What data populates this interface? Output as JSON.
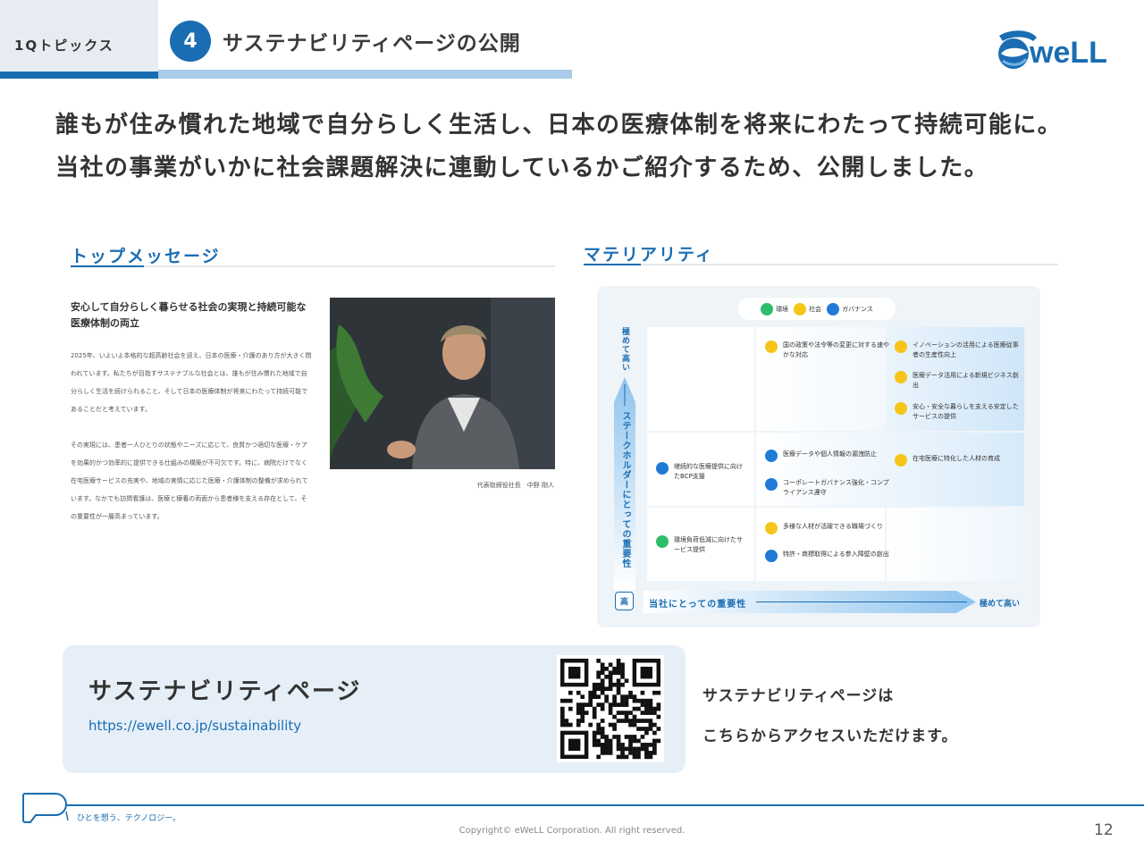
{
  "header": {
    "section_tab": "1Qトピックス",
    "topic_number": "4",
    "topic_title": "サステナビリティページの公開",
    "logo_text": "weLL"
  },
  "lead": {
    "line1": "誰もが住み慣れた地域で自分らしく生活し、日本の医療体制を将来にわたって持続可能に。",
    "line2": "当社の事業がいかに社会課題解決に連動しているかご紹介するため、公開しました。"
  },
  "top_message": {
    "title": "トップメッセージ",
    "heading": "安心して自分らしく暮らせる社会の実現と持続可能な医療体制の両立",
    "paragraph1": "2025年、いよいよ本格的な超高齢社会を迎え、日本の医療・介護のあり方が大きく問われています。私たちが目指すサステナブルな社会とは、誰もが住み慣れた地域で自分らしく生活を続けられること、そして日本の医療体制が将来にわたって持続可能であることだと考えています。",
    "paragraph2": "その実現には、患者一人ひとりの状態やニーズに応じて、良質かつ適切な医療・ケアを効果的かつ効率的に提供できる仕組みの構築が不可欠です。特に、病院だけでなく在宅医療サービスの充実や、地域の実情に応じた医療・介護体制の整備が求められています。なかでも訪問看護は、医療と療養の両面から患者様を支える存在として、その重要性が一層高まっています。",
    "caption": "代表取締役社長　中野 剛人"
  },
  "materiality": {
    "title": "マテリアリティ",
    "legend": [
      {
        "label": "環境",
        "color": "#2ebd6b"
      },
      {
        "label": "社会",
        "color": "#f5c518"
      },
      {
        "label": "ガバナンス",
        "color": "#1f7bd6"
      }
    ],
    "y_axis_top": "極めて高い",
    "y_axis_label": "ステークホルダーにとっての重要性",
    "y_axis_bottom": "高",
    "x_axis_label": "当社にとっての重要性",
    "x_axis_end": "極めて高い",
    "items": {
      "r1c2a": "国の政策や法令等の変更に対する速やかな対応",
      "r1c3a": "イノベーションの活用による医療従事者の生産性向上",
      "r1c3b": "医療データ活用による新規ビジネス創出",
      "r1c3c": "安心・安全な暮らしを支える安定したサービスの提供",
      "r2c1a": "継続的な医療提供に向けたBCP支援",
      "r2c2a": "医療データや個人情報の漏洩防止",
      "r2c2b": "コーポレートガバナンス強化・コンプライアンス遵守",
      "r2c3a": "在宅医療に特化した人材の育成",
      "r3c1a": "環境負荷低減に向けたサービス提供",
      "r3c2a": "多様な人材が活躍できる職場づくり",
      "r3c2b": "特許・商標取得による参入障壁の創出"
    }
  },
  "link_card": {
    "title": "サステナビリティページ",
    "url": "https://ewell.co.jp/sustainability",
    "access_line1": "サステナビリティページは",
    "access_line2": "こちらからアクセスいただけます。"
  },
  "footer": {
    "tagline": "ひとを想う、テクノロジー。",
    "copyright": "Copyright© eWeLL Corporation. All right reserved.",
    "page_number": "12"
  }
}
